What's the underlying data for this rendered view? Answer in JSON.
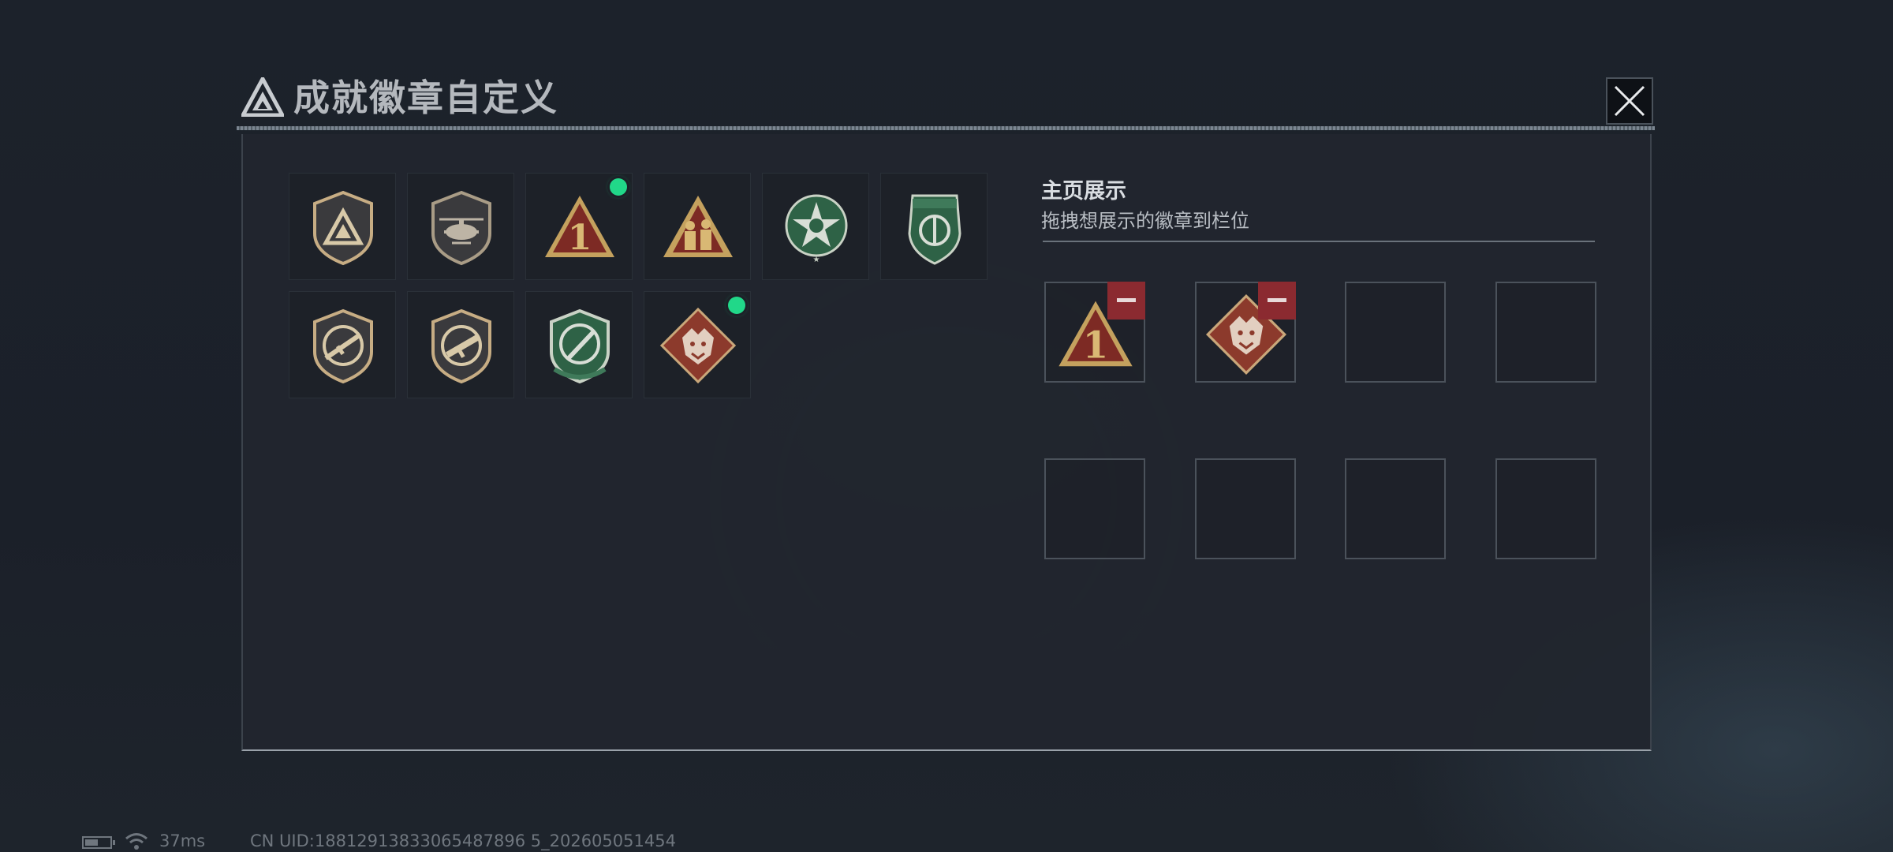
{
  "window": {
    "title": "成就徽章自定义",
    "title_tag": "",
    "close_icon": "close-icon"
  },
  "badge_collection": {
    "badges": [
      {
        "icon": "triangle-logo-shield-badge",
        "is_new": false
      },
      {
        "icon": "helicopter-shield-badge",
        "is_new": false
      },
      {
        "icon": "number-one-triangle-badge",
        "is_new": true
      },
      {
        "icon": "soldiers-triangle-badge",
        "is_new": false
      },
      {
        "icon": "green-star-medal-badge",
        "is_new": false
      },
      {
        "icon": "green-emblem-shield-badge",
        "is_new": false
      },
      {
        "icon": "rifle-crosshair-shield-badge",
        "is_new": false
      },
      {
        "icon": "smg-crosshair-shield-badge",
        "is_new": false
      },
      {
        "icon": "green-knife-shield-badge",
        "is_new": false
      },
      {
        "icon": "dragon-diamond-badge",
        "is_new": true
      }
    ]
  },
  "showcase": {
    "title": "主页展示",
    "subtitle": "拖拽想展示的徽章到栏位",
    "slots": [
      {
        "badge": "number-one-triangle-badge",
        "removable": true
      },
      {
        "badge": "dragon-diamond-badge",
        "removable": true
      },
      {
        "badge": null,
        "removable": false
      },
      {
        "badge": null,
        "removable": false
      },
      {
        "badge": null,
        "removable": false
      },
      {
        "badge": null,
        "removable": false
      },
      {
        "badge": null,
        "removable": false
      },
      {
        "badge": null,
        "removable": false
      }
    ]
  },
  "status_bar": {
    "ping": "37ms",
    "uid": "CN UID:18812913833065487896 5_202605051454",
    "battery_icon": "battery-icon",
    "wifi_icon": "wifi-icon"
  },
  "colors": {
    "new_dot": "#21d889",
    "remove_button": "#8b2a30",
    "panel_bg": "#21262e",
    "title_text": "#b4b8bd"
  }
}
